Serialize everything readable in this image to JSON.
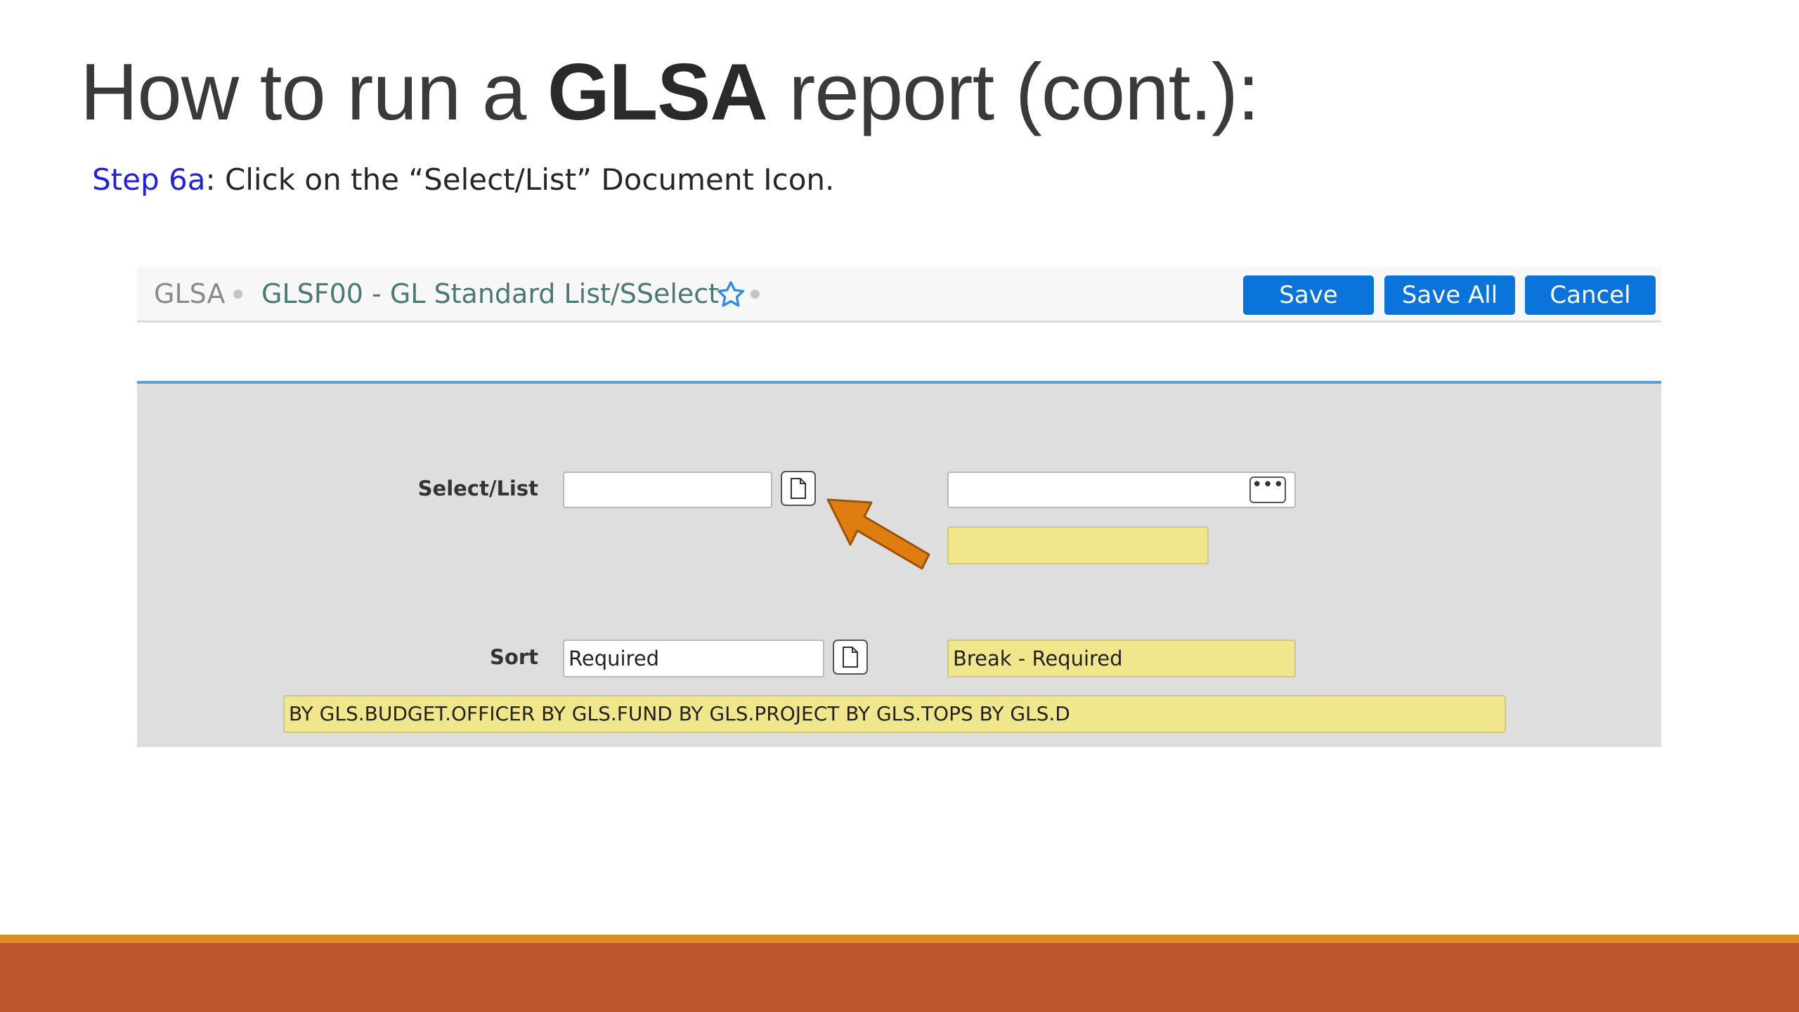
{
  "slide": {
    "title_prefix": "How to run a ",
    "title_bold": "GLSA",
    "title_suffix": " report (cont.):",
    "step_label": "Step 6a",
    "step_text": ": Click on the “Select/List” Document Icon."
  },
  "header": {
    "module": "GLSA",
    "form_title": "GLSF00 - GL Standard List/SSelect",
    "icons": {
      "favorite": "star-icon"
    },
    "buttons": {
      "save": "Save",
      "save_all": "Save All",
      "cancel": "Cancel"
    }
  },
  "form": {
    "select_list": {
      "label": "Select/List",
      "value": "",
      "lookup_value": "",
      "description": ""
    },
    "sort": {
      "label": "Sort",
      "value": "Required",
      "break_value": "Break - Required",
      "expression": "BY GLS.BUDGET.OFFICER BY GLS.FUND BY GLS.PROJECT BY GLS.TOPS BY GLS.D"
    },
    "icons": {
      "document": "document-icon",
      "lookup": "more-dots-icon"
    },
    "colors": {
      "accent": "#0a74da",
      "readonly_field": "#f0e68c",
      "arrow": "#e07d10"
    }
  }
}
